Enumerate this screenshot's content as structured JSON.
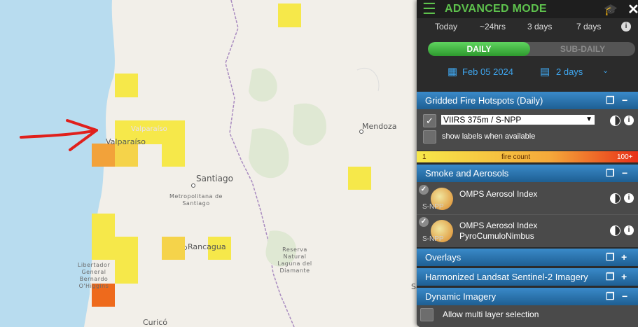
{
  "map": {
    "labels": {
      "valparaiso_region": "Valparaíso",
      "valparaiso": "Valparaíso",
      "mendoza": "Mendoza",
      "santiago": "Santiago",
      "metropolitana": "Metropolitana de Santiago",
      "rancagua": "Rancagua",
      "reserva": "Reserva Natural Laguna del Diamante",
      "libertador": "Libertador General Bernardo O'Higgins",
      "curico": "Curicó",
      "san": "Sa"
    },
    "colors": {
      "ocean": "#b8dcef",
      "land": "#f2efe9",
      "hotspot_yellow": "#f6e84a",
      "hotspot_orange": "#f2a23a",
      "hotspot_red": "#ee6a1c",
      "arrow": "#e0201c",
      "border": "#a98bc0"
    }
  },
  "panel": {
    "header": {
      "menu_icon": "hamburger-menu-icon",
      "title": "ADVANCED MODE",
      "cap_icon": "graduation-cap-icon",
      "close_icon": "close-icon"
    },
    "ranges": [
      "Today",
      "~24hrs",
      "3 days",
      "7 days"
    ],
    "toggle": {
      "daily": "DAILY",
      "subdaily": "SUB-DAILY",
      "selected": "daily"
    },
    "date": {
      "value": "Feb 05 2024",
      "span": "2 days"
    },
    "fire_layer": {
      "title": "Gridded Fire Hotspots (Daily)",
      "product": "VIIRS 375m / S-NPP",
      "show_labels": "show labels when available",
      "legend": {
        "min": "1",
        "label": "fire count",
        "max": "100+"
      }
    },
    "smoke_layer": {
      "title": "Smoke and Aerosols",
      "items": [
        {
          "name": "OMPS Aerosol Index",
          "sub": "",
          "tag": "S-NPP"
        },
        {
          "name": "OMPS Aerosol Index",
          "sub": "PyroCumuloNimbus",
          "tag": "S-NPP"
        }
      ]
    },
    "overlays": {
      "title": "Overlays"
    },
    "landsat": {
      "title": "Harmonized Landsat Sentinel-2 Imagery"
    },
    "dynamic": {
      "title": "Dynamic Imagery",
      "allow_multi": "Allow multi layer selection"
    }
  }
}
